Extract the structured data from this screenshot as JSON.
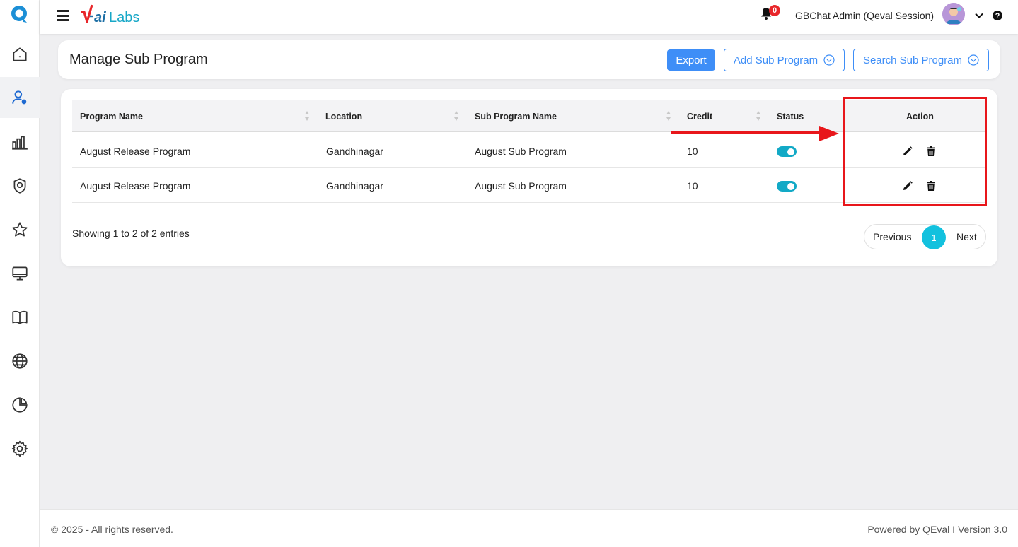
{
  "sidebar": {
    "items": [
      {
        "name": "home-icon"
      },
      {
        "name": "user-settings-icon",
        "active": true
      },
      {
        "name": "bar-chart-icon"
      },
      {
        "name": "badge-icon"
      },
      {
        "name": "star-icon"
      },
      {
        "name": "monitor-icon"
      },
      {
        "name": "book-icon"
      },
      {
        "name": "globe-icon"
      },
      {
        "name": "pie-chart-icon"
      },
      {
        "name": "gear-icon"
      }
    ]
  },
  "topbar": {
    "notification_count": "0",
    "user_name": "GBChat Admin (Qeval Session)"
  },
  "header": {
    "title": "Manage Sub Program",
    "export_label": "Export",
    "add_label": "Add Sub Program",
    "search_label": "Search Sub Program"
  },
  "table": {
    "columns": {
      "program_name": "Program Name",
      "location": "Location",
      "sub_program_name": "Sub Program Name",
      "credit": "Credit",
      "status": "Status",
      "action": "Action"
    },
    "rows": [
      {
        "program_name": "August Release Program",
        "location": "Gandhinagar",
        "sub_program_name": "August Sub Program",
        "credit": "10",
        "status": "on"
      },
      {
        "program_name": "August Release Program",
        "location": "Gandhinagar",
        "sub_program_name": "August Sub Program",
        "credit": "10",
        "status": "on"
      }
    ],
    "showing": "Showing 1 to 2 of 2 entries"
  },
  "pagination": {
    "previous": "Previous",
    "current": "1",
    "next": "Next"
  },
  "footer": {
    "copyright": "© 2025 - All rights reserved.",
    "powered": "Powered by QEval I Version 3.0"
  },
  "colors": {
    "accent": "#3e8ef7",
    "toggle": "#12a9c6",
    "page_active": "#13c1de",
    "annotation": "#e8161b"
  }
}
